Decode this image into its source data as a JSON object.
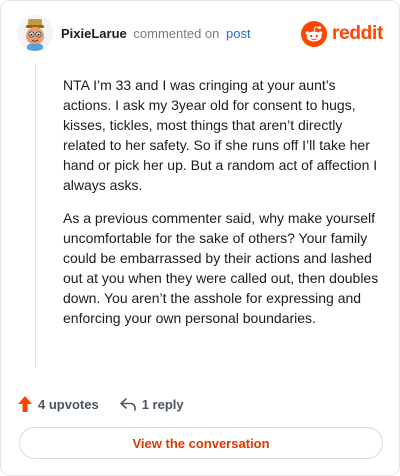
{
  "comment": {
    "author": "PixieLarue",
    "action_text": "commented on",
    "post_link_text": "post",
    "paragraphs": [
      "NTA I’m 33 and I was cringing at your aunt’s actions. I ask my 3year old for consent to hugs, kisses, tickles, most things that aren’t directly related to her safety. So if she runs off I’ll take her hand or pick her up. But a random act of affection I always asks.",
      "As a previous commenter said, why make yourself uncomfortable for the sake of others? Your family could be embarrassed by their actions and lashed out at you when they were called out, then doubles down. You aren’t the asshole for expressing and enforcing your own personal boundaries."
    ]
  },
  "brand": {
    "name": "reddit",
    "color": "#ff4500"
  },
  "actions": {
    "upvotes_label": "4 upvotes",
    "reply_label": "1 reply",
    "upvote_color": "#ff4500"
  },
  "footer": {
    "view_conversation_label": "View the conversation",
    "button_color": "#d93a00"
  },
  "icons": [
    "user-avatar",
    "reddit-logo-icon",
    "upvote-arrow-icon",
    "reply-arrow-icon"
  ]
}
